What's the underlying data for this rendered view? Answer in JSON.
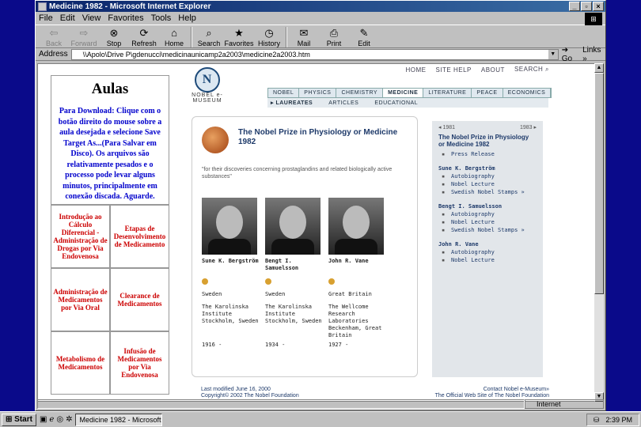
{
  "window": {
    "title": "Medicine 1982 - Microsoft Internet Explorer"
  },
  "menu": [
    "File",
    "Edit",
    "View",
    "Favorites",
    "Tools",
    "Help"
  ],
  "toolbar": [
    {
      "label": "Back",
      "icon": "back-arrow-icon",
      "disabled": true
    },
    {
      "label": "Forward",
      "icon": "forward-arrow-icon",
      "disabled": true
    },
    {
      "label": "Stop",
      "icon": "stop-icon"
    },
    {
      "label": "Refresh",
      "icon": "refresh-icon"
    },
    {
      "label": "Home",
      "icon": "home-icon"
    },
    {
      "label": "Search",
      "icon": "search-icon"
    },
    {
      "label": "Favorites",
      "icon": "favorites-icon"
    },
    {
      "label": "History",
      "icon": "history-icon"
    },
    {
      "label": "Mail",
      "icon": "mail-icon"
    },
    {
      "label": "Print",
      "icon": "print-icon"
    },
    {
      "label": "Edit",
      "icon": "edit-icon"
    }
  ],
  "address": {
    "label": "Address",
    "value": "\\\\Apolo\\Drive P\\gdenucci\\medicinaunicamp2a2003\\medicine2a2003.htm",
    "go": "Go",
    "links": "Links"
  },
  "left": {
    "title": "Aulas",
    "instructions": "Para Download: Clique com o botão direito do mouse sobre a aula desejada e selecione Save Target As...(Para Salvar em Disco). Os arquivos são relativamente pesados e o processo pode levar alguns minutos, principalmente em conexão discada. Aguarde.",
    "cells": [
      "Introdução ao Cálculo Diferencial - Administração de Drogas por Via Endovenosa",
      "Etapas de Desenvolvimento de Medicamento",
      "Administração de Medicamentos por Via Oral",
      "Clearance de Medicamentos",
      "Metabolismo de Medicamentos",
      "Infusão de Medicamentos por Via Endovenosa"
    ]
  },
  "nobel": {
    "topnav": [
      "HOME",
      "SITE HELP",
      "ABOUT",
      "SEARCH"
    ],
    "logo_text": "NOBEL e-MUSEUM",
    "categories": [
      "NOBEL",
      "PHYSICS",
      "CHEMISTRY",
      "MEDICINE",
      "LITERATURE",
      "PEACE",
      "ECONOMICS"
    ],
    "active_category": "MEDICINE",
    "subnav": [
      "LAUREATES",
      "ARTICLES",
      "EDUCATIONAL"
    ],
    "prize_title": "The Nobel Prize in Physiology or Medicine 1982",
    "motivation": "\"for their discoveries concerning prostaglandins and related biologically active substances\"",
    "laureates": [
      {
        "name": "Sune K. Bergström",
        "country": "Sweden",
        "institution": "The Karolinska Institute Stockholm, Sweden",
        "born": "1916 -"
      },
      {
        "name": "Bengt I. Samuelsson",
        "country": "Sweden",
        "institution": "The Karolinska Institute Stockholm, Sweden",
        "born": "1934 -"
      },
      {
        "name": "John R. Vane",
        "country": "Great Britain",
        "institution": "The Wellcome Research Laboratories Beckenham, Great Britain",
        "born": "1927 -"
      }
    ],
    "side": {
      "prev_year": "1981",
      "next_year": "1983",
      "title": "The Nobel Prize in Physiology or Medicine 1982",
      "press": "Press Release",
      "people": [
        {
          "name": "Sune K. Bergström",
          "links": [
            "Autobiography",
            "Nobel Lecture",
            "Swedish Nobel Stamps »"
          ]
        },
        {
          "name": "Bengt I. Samuelsson",
          "links": [
            "Autobiography",
            "Nobel Lecture",
            "Swedish Nobel Stamps »"
          ]
        },
        {
          "name": "John R. Vane",
          "links": [
            "Autobiography",
            "Nobel Lecture"
          ]
        }
      ]
    },
    "footer": {
      "modified": "Last modified June 16, 2000",
      "copyright": "Copyright© 2002 The Nobel Foundation",
      "contact": "Contact Nobel e-Museum»",
      "official": "The Official Web Site of The Nobel Foundation"
    }
  },
  "status": {
    "zone": "Internet"
  },
  "taskbar": {
    "start": "Start",
    "task": "Medicine 1982 - Microsoft ...",
    "clock": "2:39 PM"
  }
}
